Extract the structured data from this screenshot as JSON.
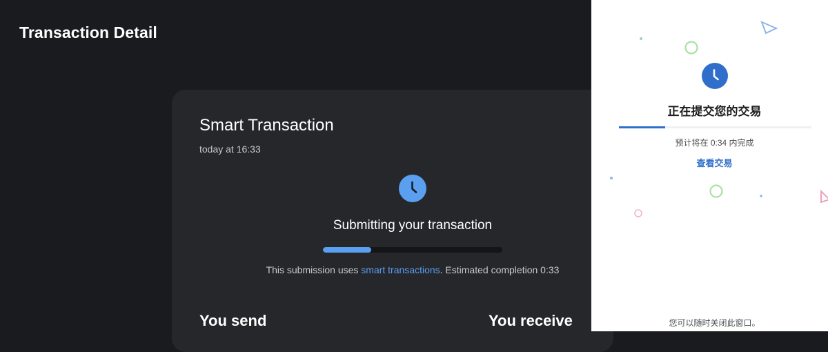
{
  "header": {
    "title": "Transaction Detail"
  },
  "transaction": {
    "title": "Smart Transaction",
    "time": "today at 16:33",
    "status_icon": "clock-icon",
    "status_text": "Submitting your transaction",
    "progress": 0.27,
    "note_prefix": "This submission uses ",
    "note_link": "smart transactions",
    "note_suffix": ". Estimated completion 0:33",
    "send_heading": "You send",
    "receive_heading": "You receive"
  },
  "popup": {
    "status_icon": "clock-icon",
    "title": "正在提交您的交易",
    "progress": 0.24,
    "eta": "预计将在 0:34 内完成",
    "view_link": "查看交易",
    "close_note": "您可以随时关闭此窗口。"
  },
  "colors": {
    "background": "#1a1b1e",
    "card": "#26272b",
    "accent_dark": "#5a9ff0",
    "accent_light": "#2f6fcb",
    "popup_bg": "#ffffff"
  }
}
